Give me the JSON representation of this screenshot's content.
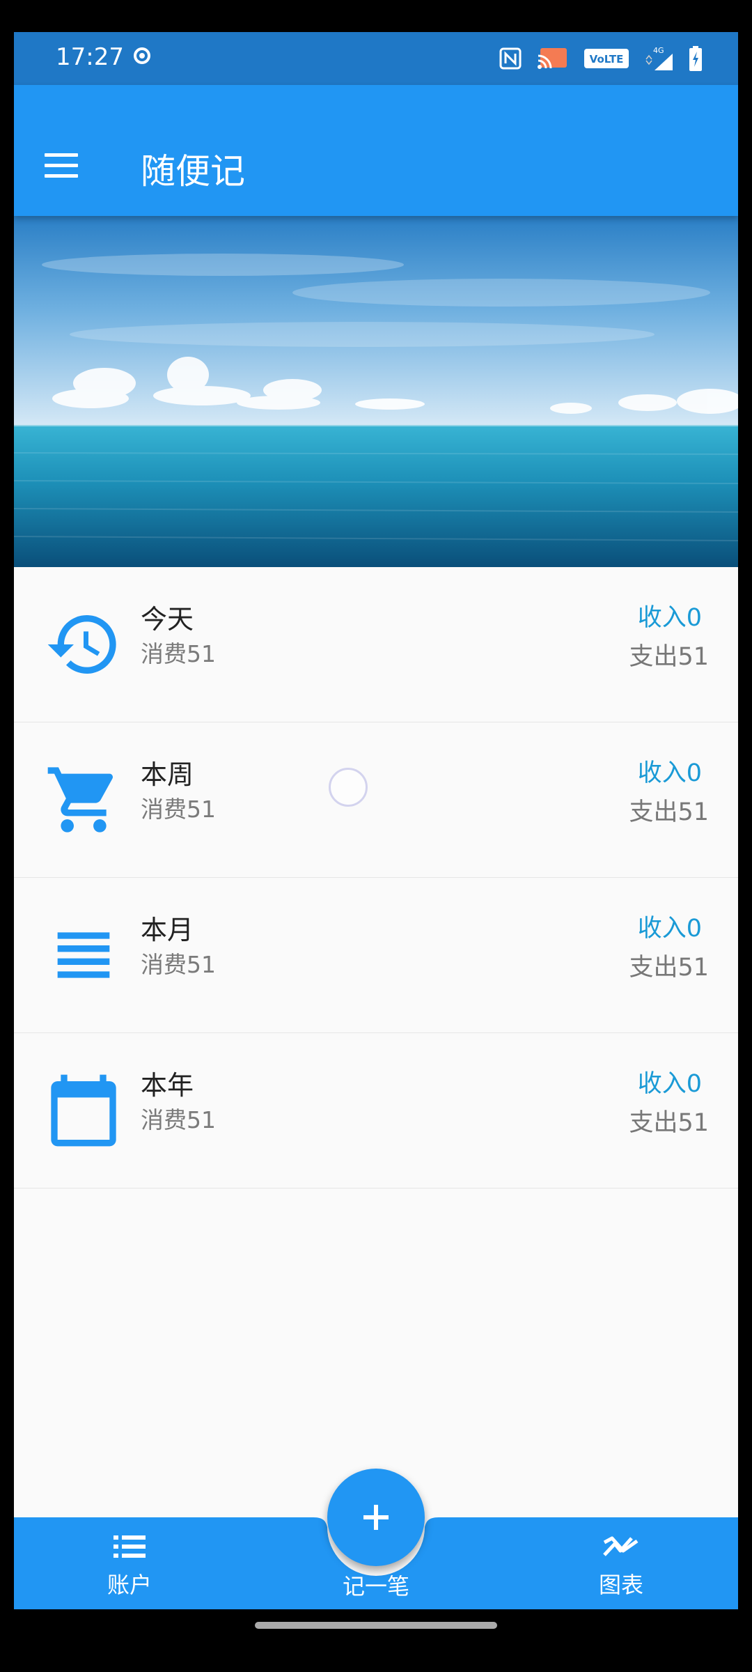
{
  "status_bar": {
    "time": "17:27",
    "network": "4G",
    "volte": "VoLTE"
  },
  "app_bar": {
    "title": "随便记",
    "menu_icon": "menu-icon"
  },
  "banner": {
    "description_icon": "sea-sky-banner-image"
  },
  "summaries": [
    {
      "icon": "history-icon",
      "title": "今天",
      "subtitle": "消费51",
      "income": "收入0",
      "expense": "支出51"
    },
    {
      "icon": "cart-icon",
      "title": "本周",
      "subtitle": "消费51",
      "income": "收入0",
      "expense": "支出51"
    },
    {
      "icon": "list-lines-icon",
      "title": "本月",
      "subtitle": "消费51",
      "income": "收入0",
      "expense": "支出51"
    },
    {
      "icon": "calendar-icon",
      "title": "本年",
      "subtitle": "消费51",
      "income": "收入0",
      "expense": "支出51"
    }
  ],
  "bottom_nav": {
    "accounts_label": "账户",
    "add_label": "记一笔",
    "charts_label": "图表"
  },
  "colors": {
    "primary": "#2196f3",
    "status_bar": "#1f78c6",
    "income": "#1a9ad6",
    "expense": "#777777"
  }
}
